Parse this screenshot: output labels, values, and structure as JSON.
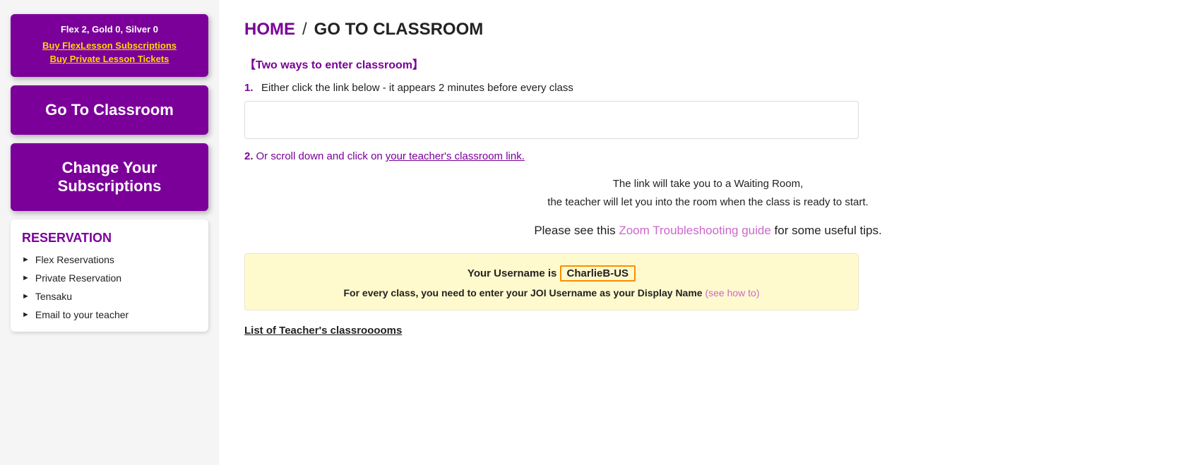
{
  "sidebar": {
    "subscription_info": "Flex 2, Gold 0, Silver 0",
    "buy_flex_label": "Buy FlexLesson Subscriptions",
    "buy_private_label": "Buy Private Lesson Tickets",
    "go_to_classroom_label": "Go To Classroom",
    "change_subscriptions_label": "Change Your Subscriptions",
    "reservation_title": "RESERVATION",
    "reservation_items": [
      {
        "label": "Flex Reservations"
      },
      {
        "label": "Private Reservation"
      },
      {
        "label": "Tensaku"
      },
      {
        "label": "Email to your teacher"
      }
    ]
  },
  "main": {
    "breadcrumb_home": "HOME",
    "breadcrumb_separator": "/",
    "breadcrumb_current": "GO TO CLASSROOM",
    "two_ways_title": "【Two ways to enter classroom】",
    "step1_num": "1.",
    "step1_text": "Either click the link below - it appears 2 minutes before every class",
    "step2_num": "2.",
    "step2_text": "Or scroll down and click on ",
    "step2_link": "your teacher's classroom link.",
    "waiting_room_line1": "The link will take you to a Waiting Room,",
    "waiting_room_line2": "the teacher will let you into the room when the class is ready to start.",
    "troubleshoot_text": "Please see this ",
    "troubleshoot_link": "Zoom Troubleshooting guide",
    "troubleshoot_suffix": " for some useful tips.",
    "username_label": "Your Username is ",
    "username_value": "CharlieB-US",
    "display_name_text": "For every class, you need to enter your JOI Username as your Display Name ",
    "display_name_link": "(see how to)",
    "teacher_list_label": "List of Teacher's classrooooms"
  }
}
